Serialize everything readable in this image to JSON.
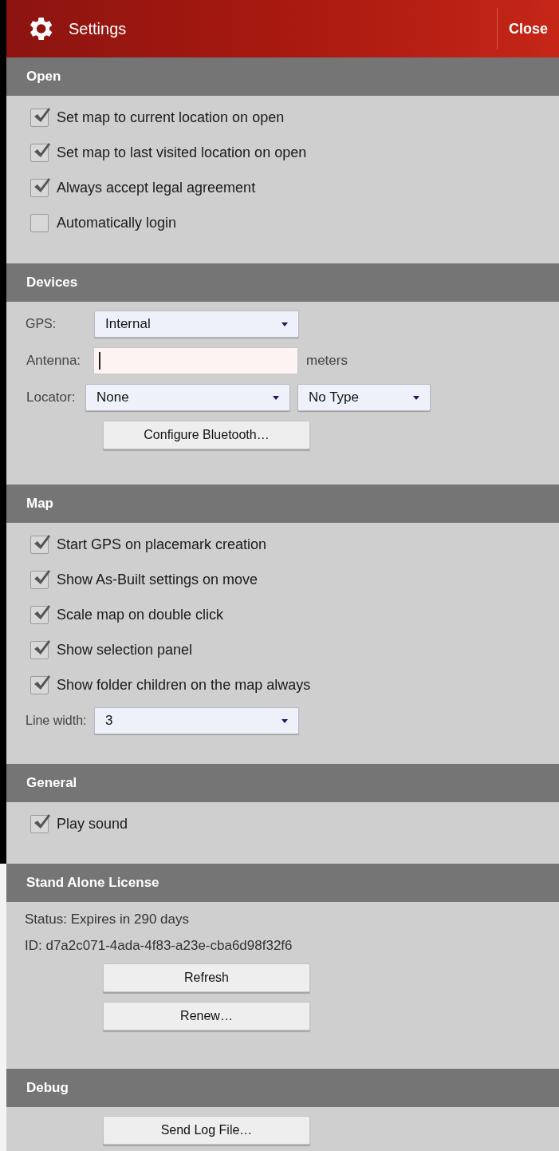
{
  "header": {
    "title": "Settings",
    "close": "Close"
  },
  "sections": [
    {
      "title": "Open",
      "items": [
        {
          "kind": "checkbox",
          "label": "Set map to current location on open",
          "checked": true
        },
        {
          "kind": "checkbox",
          "label": "Set map to last visited location on open",
          "checked": true
        },
        {
          "kind": "checkbox",
          "label": "Always accept legal agreement",
          "checked": true
        },
        {
          "kind": "checkbox",
          "label": "Automatically login",
          "checked": false
        }
      ]
    },
    {
      "title": "Devices",
      "items": [
        {
          "kind": "select",
          "label": "GPS:",
          "value": "Internal"
        },
        {
          "kind": "input",
          "label": "Antenna:",
          "unit": "meters"
        },
        {
          "kind": "select_pair",
          "label": "Locator:",
          "values": [
            "None",
            "No Type"
          ]
        },
        {
          "kind": "button",
          "label": "Configure Bluetooth…"
        }
      ]
    },
    {
      "title": "Map",
      "items": [
        {
          "kind": "checkbox",
          "label": "Start GPS on placemark creation",
          "checked": true
        },
        {
          "kind": "checkbox",
          "label": "Show As-Built settings on move",
          "checked": true
        },
        {
          "kind": "checkbox",
          "label": "Scale map on double click",
          "checked": true
        },
        {
          "kind": "checkbox",
          "label": "Show selection panel",
          "checked": true
        },
        {
          "kind": "checkbox",
          "label": "Show folder children on the map always",
          "checked": true
        },
        {
          "kind": "select",
          "label": "Line width:",
          "value": "3"
        }
      ]
    },
    {
      "title": "General",
      "items": [
        {
          "kind": "checkbox",
          "label": "Play sound",
          "checked": true
        }
      ]
    },
    {
      "title": "Stand Alone License",
      "items": [
        {
          "kind": "text",
          "label": "Status: Expires in 290 days"
        },
        {
          "kind": "text",
          "label": "ID: d7a2c071-4ada-4f83-a23e-cba6d98f32f6"
        },
        {
          "kind": "button",
          "label": "Refresh"
        },
        {
          "kind": "button",
          "label": "Renew…"
        }
      ]
    },
    {
      "title": "Debug",
      "items": [
        {
          "kind": "button",
          "label": "Send Log File…"
        }
      ]
    }
  ]
}
